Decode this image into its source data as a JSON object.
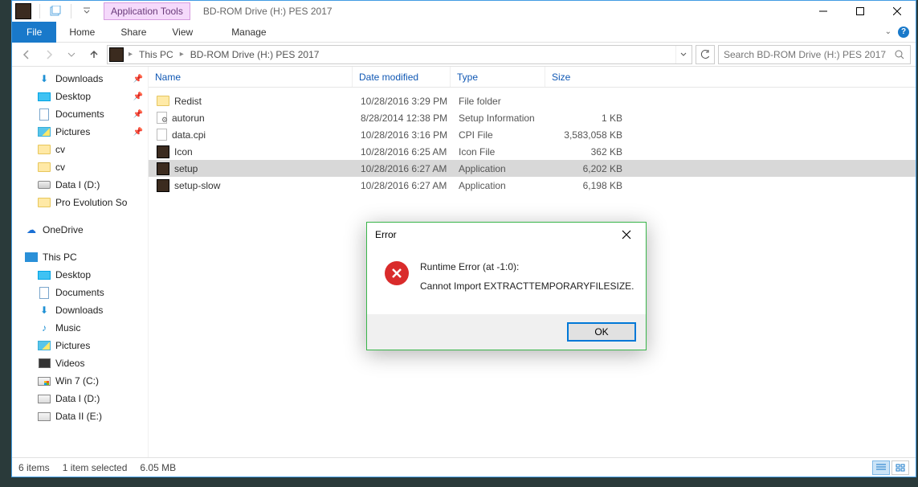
{
  "window": {
    "apptools_label": "Application Tools",
    "title": "BD-ROM Drive (H:) PES 2017"
  },
  "ribbon": {
    "file": "File",
    "tabs": [
      "Home",
      "Share",
      "View"
    ],
    "manage": "Manage"
  },
  "breadcrumb": {
    "segments": [
      "This PC",
      "BD-ROM Drive (H:) PES 2017"
    ]
  },
  "search": {
    "placeholder": "Search BD-ROM Drive (H:) PES 2017"
  },
  "sidebar": {
    "quick": [
      {
        "label": "Downloads",
        "icon": "down",
        "pinned": true
      },
      {
        "label": "Desktop",
        "icon": "desk",
        "pinned": true
      },
      {
        "label": "Documents",
        "icon": "doc",
        "pinned": true
      },
      {
        "label": "Pictures",
        "icon": "pic",
        "pinned": true
      },
      {
        "label": "cv",
        "icon": "folder"
      },
      {
        "label": "cv",
        "icon": "folder"
      },
      {
        "label": "Data I (D:)",
        "icon": "drive"
      },
      {
        "label": "Pro Evolution So",
        "icon": "folder"
      }
    ],
    "onedrive": "OneDrive",
    "thispc_label": "This PC",
    "thispc": [
      {
        "label": "Desktop",
        "icon": "desk"
      },
      {
        "label": "Documents",
        "icon": "doc"
      },
      {
        "label": "Downloads",
        "icon": "down"
      },
      {
        "label": "Music",
        "icon": "mus"
      },
      {
        "label": "Pictures",
        "icon": "pic"
      },
      {
        "label": "Videos",
        "icon": "vid"
      },
      {
        "label": "Win 7 (C:)",
        "icon": "drv-win"
      },
      {
        "label": "Data I (D:)",
        "icon": "drv"
      },
      {
        "label": "Data II (E:)",
        "icon": "drv"
      }
    ]
  },
  "columns": {
    "name": "Name",
    "date": "Date modified",
    "type": "Type",
    "size": "Size"
  },
  "files": [
    {
      "name": "Redist",
      "date": "10/28/2016 3:29 PM",
      "type": "File folder",
      "size": "",
      "icon": "folder",
      "selected": false
    },
    {
      "name": "autorun",
      "date": "8/28/2014 12:38 PM",
      "type": "Setup Information",
      "size": "1 KB",
      "icon": "cfg",
      "selected": false
    },
    {
      "name": "data.cpi",
      "date": "10/28/2016 3:16 PM",
      "type": "CPI File",
      "size": "3,583,058 KB",
      "icon": "cpi",
      "selected": false
    },
    {
      "name": "Icon",
      "date": "10/28/2016 6:25 AM",
      "type": "Icon File",
      "size": "362 KB",
      "icon": "app",
      "selected": false
    },
    {
      "name": "setup",
      "date": "10/28/2016 6:27 AM",
      "type": "Application",
      "size": "6,202 KB",
      "icon": "app",
      "selected": true
    },
    {
      "name": "setup-slow",
      "date": "10/28/2016 6:27 AM",
      "type": "Application",
      "size": "6,198 KB",
      "icon": "app",
      "selected": false
    }
  ],
  "status": {
    "items": "6 items",
    "selected": "1 item selected",
    "size": "6.05 MB"
  },
  "dialog": {
    "title": "Error",
    "line1": "Runtime Error (at -1:0):",
    "line2": "Cannot Import EXTRACTTEMPORARYFILESIZE.",
    "ok": "OK"
  }
}
